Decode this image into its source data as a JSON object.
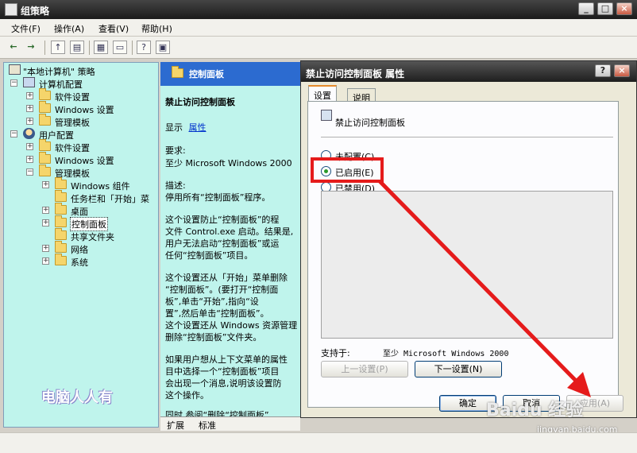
{
  "window": {
    "title": "组策略",
    "icon": "gpedit-icon"
  },
  "menu": [
    "文件(F)",
    "操作(A)",
    "查看(V)",
    "帮助(H)"
  ],
  "toolbar": {
    "buttons": [
      "back-icon",
      "forward-icon",
      "up-icon",
      "show-hide-tree-icon",
      "properties-icon",
      "export-icon",
      "help-icon",
      "console-icon"
    ]
  },
  "tree": {
    "root": "\"本地计算机\" 策略",
    "computer_config": "计算机配置",
    "cc_software": "软件设置",
    "cc_windows": "Windows 设置",
    "cc_admin": "管理模板",
    "user_config": "用户配置",
    "uc_software": "软件设置",
    "uc_windows": "Windows 设置",
    "uc_admin": "管理模板",
    "win_components": "Windows 组件",
    "taskbar": "任务栏和「开始」菜",
    "desktop": "桌面",
    "control_panel": "控制面板",
    "shared_folders": "共享文件夹",
    "network": "网络",
    "system": "系统"
  },
  "middle": {
    "header": "控制面板",
    "policy_title": "禁止访问控制面板",
    "display_label": "显示",
    "properties_link": "属性",
    "req_label": "要求:",
    "req_value": "至少 Microsoft Windows 2000",
    "desc_label": "描述:",
    "desc_line1": "停用所有“控制面板”程序。",
    "p1": [
      "这个设置防止“控制面板”的程",
      "文件 Control.exe 启动。结果是,",
      "用户无法启动“控制面板”或运",
      "任何“控制面板”项目。"
    ],
    "p2": [
      "这个设置还从「开始」菜单删除",
      "“控制面板”。(要打开“控制面",
      "板”,单击“开始”,指向“设",
      "置”,然后单击“控制面板”。",
      "这个设置还从 Windows 资源管理",
      "删除“控制面板”文件夹。"
    ],
    "p3": [
      "如果用户想从上下文菜单的属性",
      "目中选择一个“控制面板”项目",
      "会出现一个消息,说明该设置防",
      "这个操作。"
    ],
    "p4": "同时,参阅“删除“控制面板”",
    "tab_extended": "扩展",
    "tab_standard": "标准"
  },
  "watermark": "电脑人人有",
  "dialog": {
    "title": "禁止访问控制面板 属性",
    "tab_settings": "设置",
    "tab_explain": "说明",
    "setting_name": "禁止访问控制面板",
    "opt_not_configured": "未配置(C)",
    "opt_enabled": "已启用(E)",
    "opt_disabled": "已禁用(D)",
    "selected": "enabled",
    "supported_label": "支持于:",
    "supported_value": "至少 Microsoft Windows 2000",
    "prev_setting": "上一设置(P)",
    "next_setting": "下一设置(N)",
    "ok": "确定",
    "cancel": "取消",
    "apply": "应用(A)"
  },
  "annotation": {
    "color": "#e51b1b"
  },
  "brand": {
    "watermark": "Baidu 经验",
    "url": "jingyan.baidu.com"
  }
}
